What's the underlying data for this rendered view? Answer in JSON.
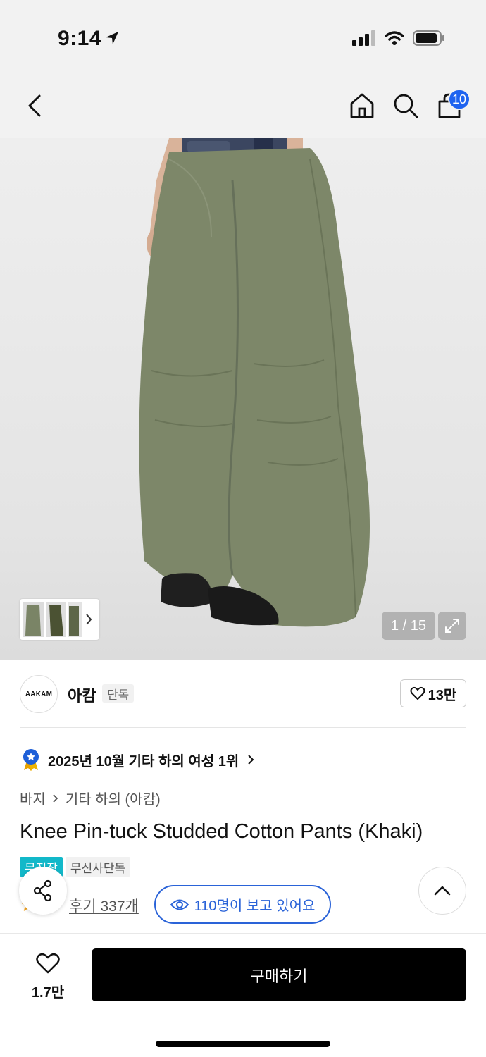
{
  "status": {
    "time": "9:14"
  },
  "nav": {
    "cart_count": "10"
  },
  "gallery": {
    "counter": "1 / 15"
  },
  "brand": {
    "logo_text": "AAKAM",
    "name": "아캄",
    "tag": "단독",
    "likes": "13만"
  },
  "ranking": {
    "text": "2025년 10월 기타 하의 여성 1위"
  },
  "breadcrumb": {
    "category": "바지",
    "subcategory": "기타 하의 (아캄)"
  },
  "product": {
    "title": "Knee Pin-tuck Studded Cotton Pants (Khaki)",
    "tags": [
      "무진장",
      "무신사단독"
    ],
    "reviews": "후기 337개",
    "viewers": "110명이 보고 있어요"
  },
  "bottom": {
    "wish_count": "1.7만",
    "buy_label": "구매하기"
  },
  "colors": {
    "accent_blue": "#2a63d8",
    "badge_blue": "#1e63f0",
    "tag_teal": "#12b8c9",
    "pants_khaki": "#7d8769"
  }
}
